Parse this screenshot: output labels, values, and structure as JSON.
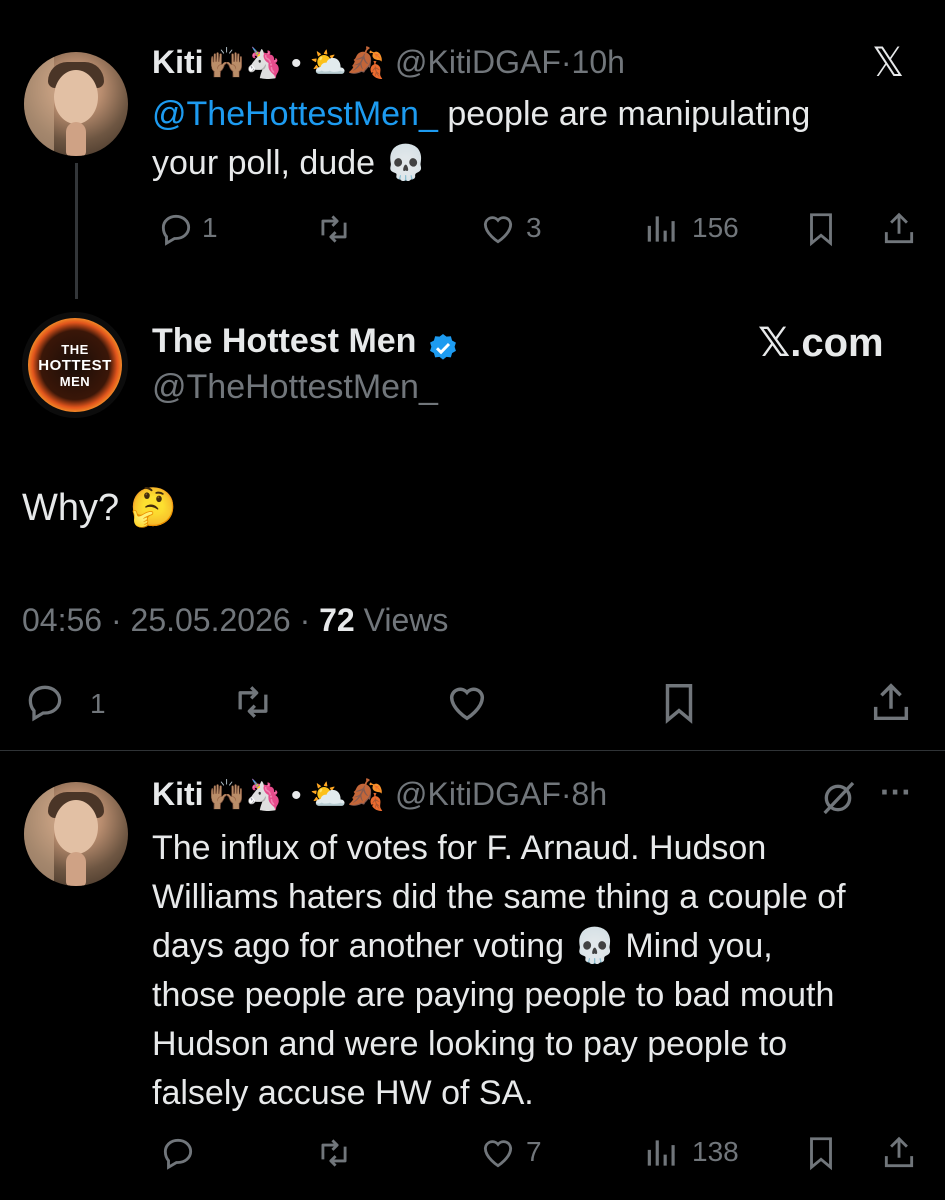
{
  "tweet1": {
    "display_name": "Kiti",
    "name_emojis": "🙌🏽🦄 • ⛅🍂",
    "handle": "@KitiDGAF",
    "dot": "·",
    "time": "10h",
    "x_logo": "𝕏",
    "mention": "@TheHottestMen_",
    "text_after_mention": " people are manipulating",
    "text_line2": "your poll, dude",
    "text_emoji": "💀",
    "replies": "1",
    "likes": "3",
    "views": "156"
  },
  "tweet2": {
    "avatar_text_line1": "THE",
    "avatar_text_line2": "HOTTEST",
    "avatar_text_line3": "MEN",
    "display_name": "The Hottest Men",
    "handle": "@TheHottestMen_",
    "site_label": "𝕏.com",
    "text": "Why?",
    "text_emoji": "🤔",
    "time": "04:56",
    "dot1": "·",
    "date": "25.05.2026",
    "dot2": "·",
    "views_count": "72",
    "views_label": "Views",
    "replies": "1"
  },
  "tweet3": {
    "display_name": "Kiti",
    "name_emojis": "🙌🏽🦄 • ⛅🍂",
    "handle": "@KitiDGAF",
    "dot": "·",
    "time": "8h",
    "more": "···",
    "line1": "The influx of votes for F. Arnaud. Hudson",
    "line2": "Williams haters did the same thing a couple of",
    "line3a": "days ago for another voting",
    "line3_emoji": "💀",
    "line3b": "Mind you,",
    "line4": "those people are paying people to bad mouth",
    "line5": "Hudson and were looking to pay people to",
    "line6": "falsely accuse HW of SA.",
    "likes": "7",
    "views": "138"
  },
  "colors": {
    "background": "#000000",
    "text": "#e7e9ea",
    "secondary": "#71767b",
    "link": "#1d9bf0",
    "divider": "#2f3336"
  },
  "icons": [
    "reply-icon",
    "retweet-icon",
    "like-icon",
    "views-icon",
    "bookmark-icon",
    "share-icon",
    "verified-icon",
    "grok-icon",
    "more-icon"
  ]
}
